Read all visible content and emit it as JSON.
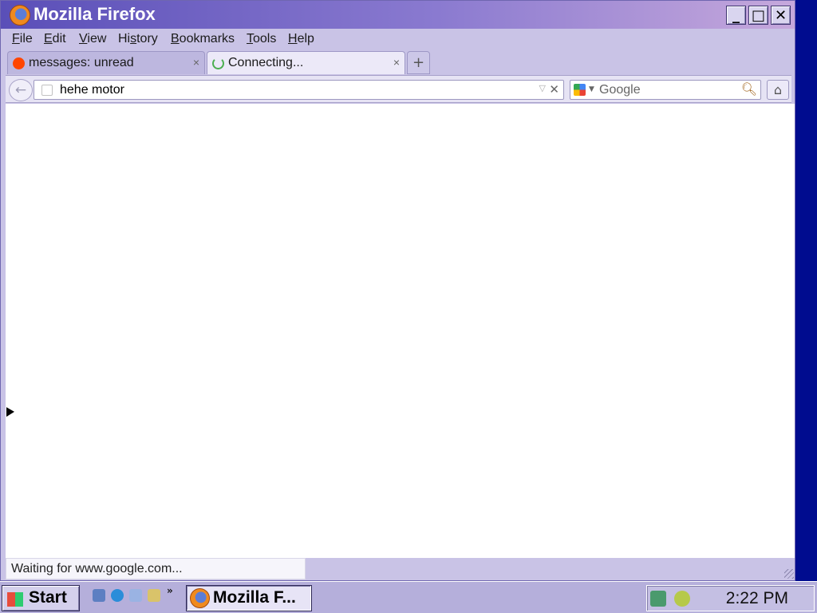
{
  "window": {
    "title": "Mozilla Firefox"
  },
  "title_buttons": {
    "minimize": "_",
    "maximize": "□",
    "close": "✕"
  },
  "menus": [
    {
      "label": "File",
      "key": "F",
      "rest": "ile"
    },
    {
      "label": "Edit",
      "key": "E",
      "rest": "dit"
    },
    {
      "label": "View",
      "key": "V",
      "rest": "iew"
    },
    {
      "label": "History",
      "key": "s",
      "pre": "Hi",
      "rest": "tory"
    },
    {
      "label": "Bookmarks",
      "key": "B",
      "rest": "ookmarks"
    },
    {
      "label": "Tools",
      "key": "T",
      "rest": "ools"
    },
    {
      "label": "Help",
      "key": "H",
      "rest": "elp"
    }
  ],
  "tabs": [
    {
      "label": "messages: unread",
      "close": "×",
      "active": false,
      "icon": "reddit-icon",
      "icon_color": "#ff4500"
    },
    {
      "label": "Connecting...",
      "close": "×",
      "active": true,
      "icon": "loading-spinner-icon",
      "icon_color": "#4caf50"
    }
  ],
  "new_tab": "+",
  "navbar": {
    "back": "←",
    "url_value": "hehe motor",
    "url_dropdown": "▽",
    "url_clear": "✕",
    "search_placeholder": "Google",
    "search_engine_icon": "google-icon",
    "search_icon": "magnifier-icon",
    "home": "⌂"
  },
  "status": {
    "text": "Waiting for www.google.com..."
  },
  "taskbar": {
    "start_label": "Start",
    "quick_more": "»",
    "task_label": "Mozilla F...",
    "clock": "2:22 PM"
  }
}
